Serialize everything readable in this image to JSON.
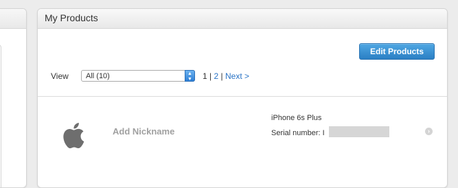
{
  "panel": {
    "title": "My Products",
    "edit_button": "Edit Products",
    "view_label": "View",
    "view_select_value": "All (10)",
    "pager": {
      "current": "1",
      "separator1": "|",
      "page2": "2",
      "separator2": "|",
      "next": "Next >"
    }
  },
  "product": {
    "nickname": "Add Nickname",
    "model": "iPhone 6s Plus",
    "serial_label": "Serial number: I",
    "icon": "apple-logo-icon"
  },
  "colors": {
    "accent": "#2a73c5",
    "button": "#3a8fd3"
  }
}
